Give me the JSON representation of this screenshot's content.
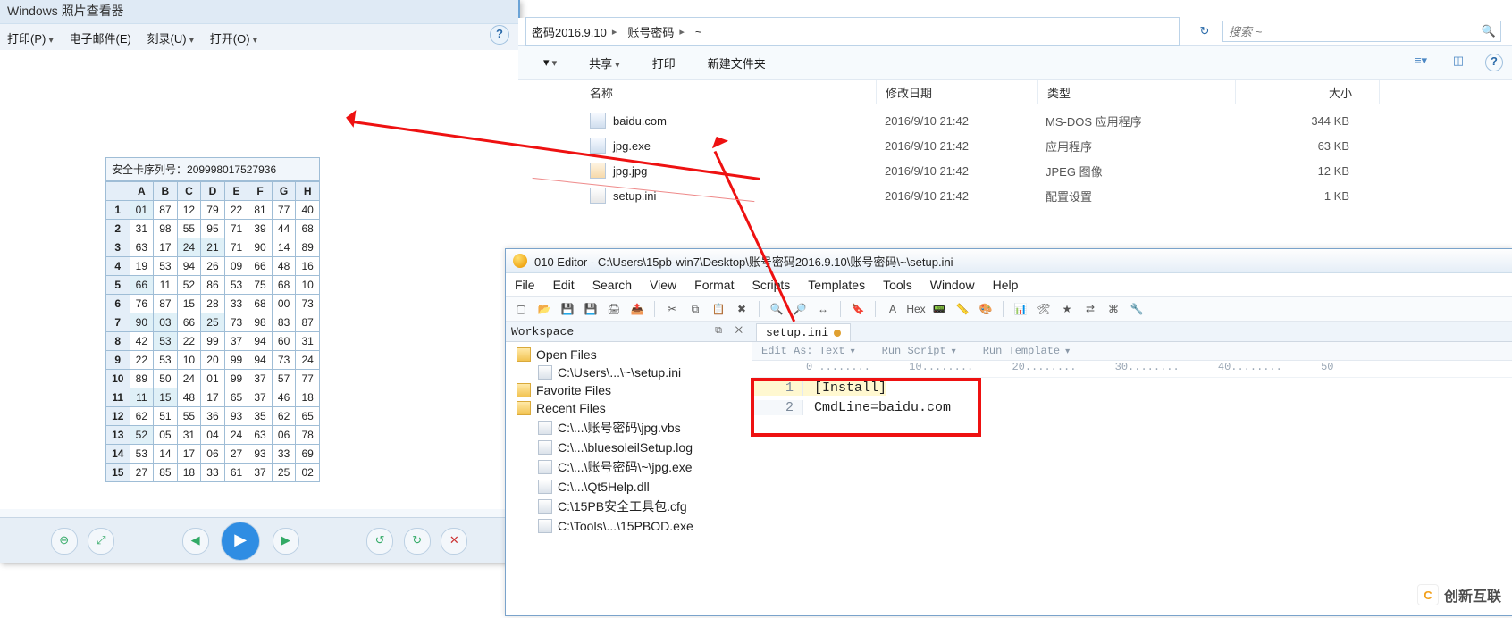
{
  "photo_viewer": {
    "title": "Windows 照片查看器",
    "toolbar": {
      "print": "打印(P)",
      "email": "电子邮件(E)",
      "burn": "刻录(U)",
      "open": "打开(O)"
    },
    "help_tooltip": "?",
    "security_card": {
      "serial_label": "安全卡序列号：",
      "serial": "209998017527936",
      "col_headers": [
        "A",
        "B",
        "C",
        "D",
        "E",
        "F",
        "G",
        "H"
      ],
      "rows": [
        [
          "01",
          "87",
          "12",
          "79",
          "22",
          "81",
          "77",
          "40"
        ],
        [
          "31",
          "98",
          "55",
          "95",
          "71",
          "39",
          "44",
          "68"
        ],
        [
          "63",
          "17",
          "24",
          "21",
          "71",
          "90",
          "14",
          "89"
        ],
        [
          "19",
          "53",
          "94",
          "26",
          "09",
          "66",
          "48",
          "16"
        ],
        [
          "66",
          "11",
          "52",
          "86",
          "53",
          "75",
          "68",
          "10"
        ],
        [
          "76",
          "87",
          "15",
          "28",
          "33",
          "68",
          "00",
          "73"
        ],
        [
          "90",
          "03",
          "66",
          "25",
          "73",
          "98",
          "83",
          "87"
        ],
        [
          "42",
          "53",
          "22",
          "99",
          "37",
          "94",
          "60",
          "31"
        ],
        [
          "22",
          "53",
          "10",
          "20",
          "99",
          "94",
          "73",
          "24"
        ],
        [
          "89",
          "50",
          "24",
          "01",
          "99",
          "37",
          "57",
          "77"
        ],
        [
          "11",
          "15",
          "48",
          "17",
          "65",
          "37",
          "46",
          "18"
        ],
        [
          "62",
          "51",
          "55",
          "36",
          "93",
          "35",
          "62",
          "65"
        ],
        [
          "52",
          "05",
          "31",
          "04",
          "24",
          "63",
          "06",
          "78"
        ],
        [
          "53",
          "14",
          "17",
          "06",
          "27",
          "93",
          "33",
          "69"
        ],
        [
          "27",
          "85",
          "18",
          "33",
          "61",
          "37",
          "25",
          "02"
        ]
      ],
      "highlight_cols_by_row": {
        "1": [
          0
        ],
        "3": [
          2,
          3
        ],
        "5": [
          0
        ],
        "7": [
          0,
          1,
          3
        ],
        "8": [
          1
        ],
        "11": [
          0,
          1
        ],
        "13": [
          0
        ]
      }
    },
    "bottom_icons": [
      "zoom-out-icon",
      "zoom-fit-icon",
      "prev-icon",
      "play-icon",
      "next-icon",
      "rotate-ccw-icon",
      "rotate-cw-icon",
      "delete-icon"
    ]
  },
  "explorer": {
    "breadcrumbs": [
      "密码2016.9.10",
      "账号密码",
      "~"
    ],
    "search_placeholder": "搜索 ~",
    "refresh_glyph": "↻",
    "toolbar": {
      "share": "共享",
      "print": "打印",
      "newfolder": "新建文件夹"
    },
    "view_icons": [
      "list-view-icon",
      "preview-pane-icon",
      "help-icon"
    ],
    "columns": {
      "name": "名称",
      "date": "修改日期",
      "type": "类型",
      "size": "大小"
    },
    "rows": [
      {
        "icon": "exe",
        "name": "baidu.com",
        "date": "2016/9/10 21:42",
        "type": "MS-DOS 应用程序",
        "size": "344 KB"
      },
      {
        "icon": "exe",
        "name": "jpg.exe",
        "date": "2016/9/10 21:42",
        "type": "应用程序",
        "size": "63 KB"
      },
      {
        "icon": "jpg",
        "name": "jpg.jpg",
        "date": "2016/9/10 21:42",
        "type": "JPEG 图像",
        "size": "12 KB"
      },
      {
        "icon": "ini",
        "name": "setup.ini",
        "date": "2016/9/10 21:42",
        "type": "配置设置",
        "size": "1 KB"
      }
    ]
  },
  "editor": {
    "title": "010 Editor - C:\\Users\\15pb-win7\\Desktop\\账号密码2016.9.10\\账号密码\\~\\setup.ini",
    "menu": [
      "File",
      "Edit",
      "Search",
      "View",
      "Format",
      "Scripts",
      "Templates",
      "Tools",
      "Window",
      "Help"
    ],
    "toolbar_icons": [
      "new",
      "open",
      "save",
      "saveall",
      "print",
      "export",
      "",
      "cut",
      "copy",
      "paste",
      "delete",
      "",
      "find",
      "findnext",
      "replace",
      "",
      "bookmark",
      "",
      "A",
      "hex-Hex",
      "calc",
      "ruler",
      "palette",
      "",
      "chart",
      "tools",
      "bookmark2",
      "compare",
      "template",
      "wrench"
    ],
    "workspace": {
      "title": "Workspace",
      "open_files_label": "Open Files",
      "open_files": [
        "C:\\Users\\...\\~\\setup.ini"
      ],
      "favorite_files_label": "Favorite Files",
      "recent_files_label": "Recent Files",
      "recent_files": [
        "C:\\...\\账号密码\\jpg.vbs",
        "C:\\...\\bluesoleilSetup.log",
        "C:\\...\\账号密码\\~\\jpg.exe",
        "C:\\...\\Qt5Help.dll",
        "C:\\15PB安全工具包.cfg",
        "C:\\Tools\\...\\15PBOD.exe"
      ]
    },
    "tab": {
      "name": "setup.ini"
    },
    "subbar": {
      "editas": "Edit As: Text",
      "runscript": "Run Script",
      "runtemplate": "Run Template"
    },
    "ruler_marks": [
      "0",
      "10",
      "20",
      "30",
      "40",
      "50"
    ],
    "lines": [
      {
        "n": "1",
        "text": "[Install]"
      },
      {
        "n": "2",
        "text": "CmdLine=baidu.com"
      }
    ]
  },
  "watermark": {
    "logo": "C",
    "text": "创新互联"
  }
}
